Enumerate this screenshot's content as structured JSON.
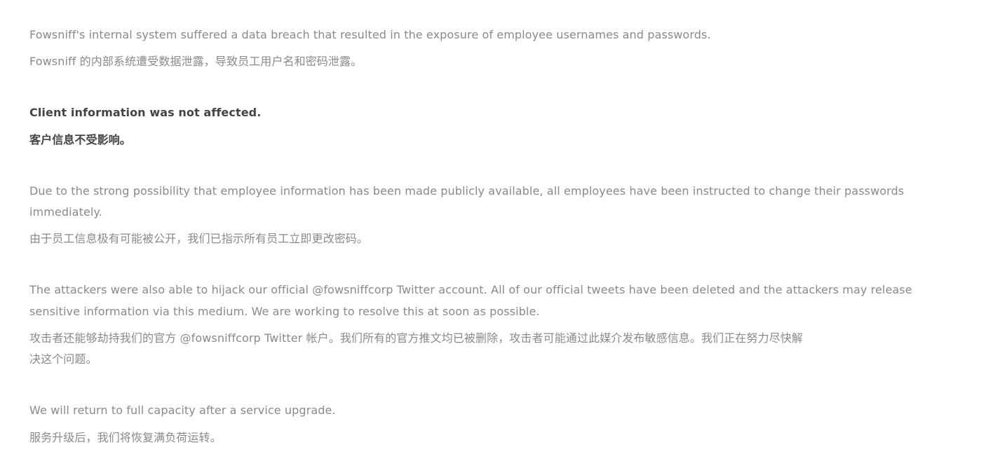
{
  "notice": {
    "p1_en": "Fowsniff's internal system suffered a data breach that resulted in the exposure of employee usernames and passwords.",
    "p1_zh": "Fowsniff 的内部系统遭受数据泄露，导致员工用户名和密码泄露。",
    "p2_en": "Client information was not affected.",
    "p2_zh": "客户信息不受影响。",
    "p3_en_line1": "Due to the strong possibility that employee information has been made publicly available, all employees have been instructed to change their passwords",
    "p3_en_line2": "immediately.",
    "p3_zh": "由于员工信息极有可能被公开，我们已指示所有员工立即更改密码。",
    "p4_en_line1": "The attackers were also able to hijack our official @fowsniffcorp Twitter account. All of our official tweets have been deleted and the attackers may release",
    "p4_en_line2": "sensitive information via this medium. We are working to resolve this at soon as possible.",
    "p4_zh_line1": "攻击者还能够劫持我们的官方 @fowsniffcorp Twitter 帐户。我们所有的官方推文均已被删除，攻击者可能通过此媒介发布敏感信息。我们正在努力尽快解",
    "p4_zh_line2": "决这个问题。",
    "p5_en": "We will return to full capacity after a service upgrade.",
    "p5_zh": "服务升级后，我们将恢复满负荷运转。"
  }
}
